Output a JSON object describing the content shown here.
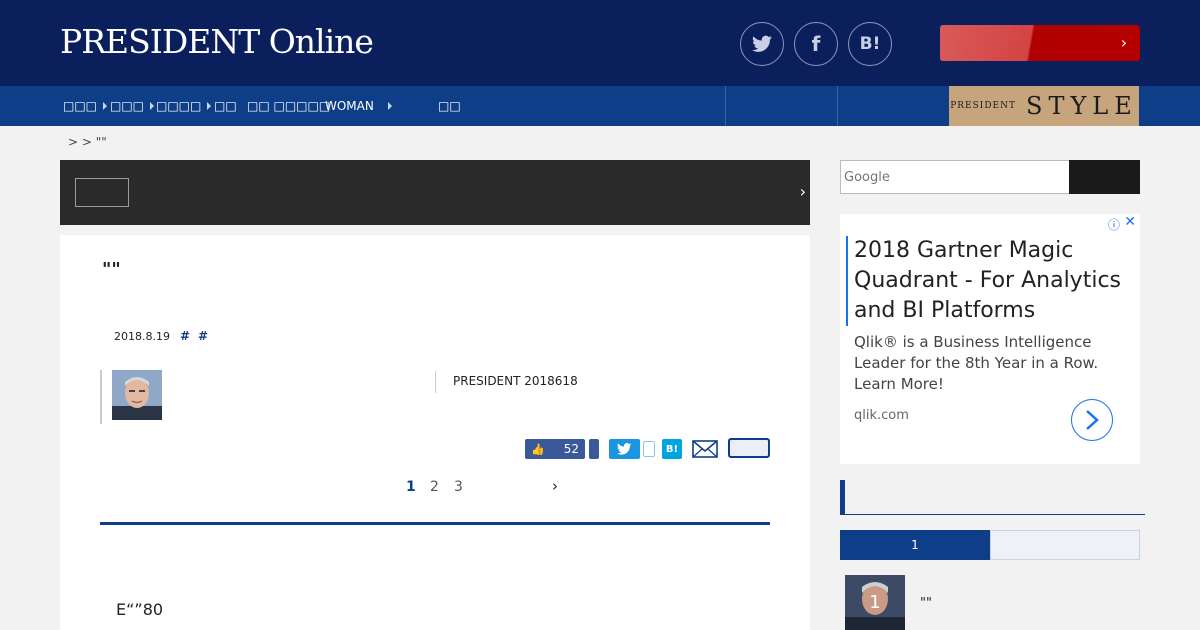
{
  "header": {
    "logo": "PRESIDENT Online",
    "social": {
      "twitter": "twitter-icon",
      "facebook": "f",
      "hatena": "B!"
    },
    "promo_arrow": "›"
  },
  "nav": {
    "items": [
      {
        "label": "□□□",
        "has_arrow": true
      },
      {
        "label": "□□□",
        "has_arrow": true
      },
      {
        "label": "□□□□",
        "has_arrow": true
      },
      {
        "label": "□□",
        "has_arrow": false
      },
      {
        "label": "□□ □□□□□",
        "has_arrow": false
      },
      {
        "label": "WOMAN",
        "has_arrow": true
      },
      {
        "label": "□□",
        "has_arrow": false
      }
    ],
    "style_badge": {
      "small": "PRESIDENT",
      "big": "STYLE"
    }
  },
  "breadcrumb": ">   > \"\"",
  "dark_bar": {
    "chevron": "›"
  },
  "article": {
    "title": "\"\"",
    "date": "2018.8.19",
    "tags": [
      "#",
      "#"
    ],
    "source": "PRESIDENT 2018618",
    "like_count": "52",
    "hatena_label": "B!",
    "pages": [
      "1",
      "2",
      "3"
    ],
    "active_page": "1",
    "next_arrow": "›",
    "body_text": "E“”80"
  },
  "sidebar": {
    "search": {
      "placeholder": "Google"
    },
    "ad": {
      "headline": "2018 Gartner Magic Quadrant - For Analytics and BI Platforms",
      "description": "Qlik® is a Business Intelligence Leader for the 8th Year in a Row. Learn More!",
      "domain": "qlik.com",
      "info_icon": "ⓘ",
      "close_icon": "✕"
    },
    "ranking": {
      "tab_active": "1",
      "items": [
        {
          "rank": "1",
          "title": "\"\""
        }
      ]
    }
  },
  "colors": {
    "header": "#0b1f5c",
    "nav": "#0f3e88",
    "accent_red": "#b50000",
    "style_gold": "#c6a57d"
  }
}
